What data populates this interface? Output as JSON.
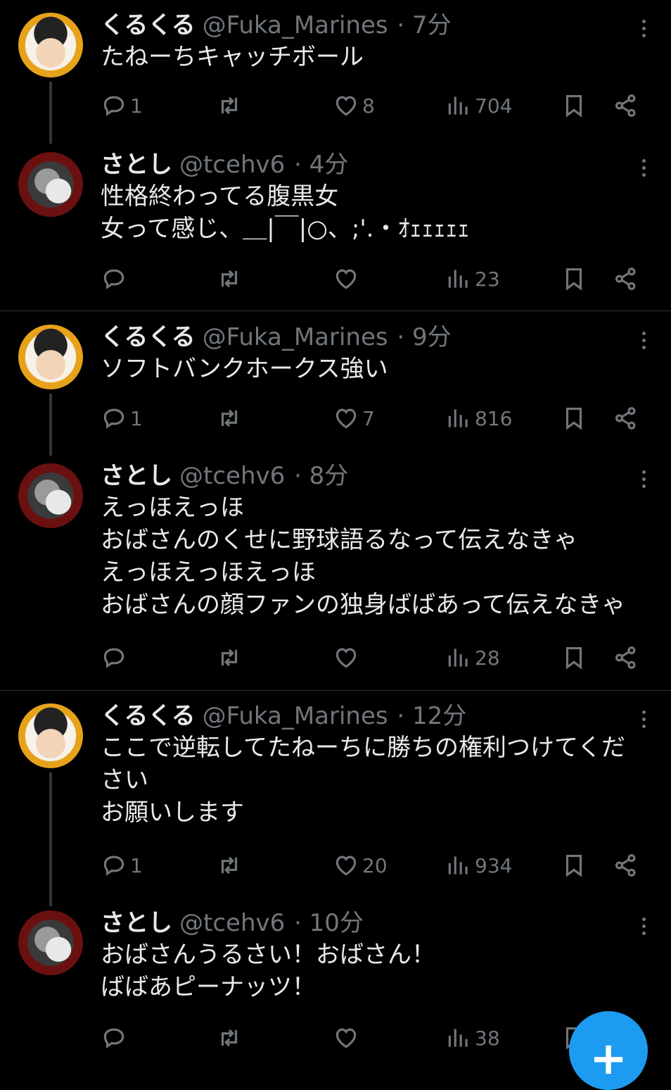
{
  "colors": {
    "background": "#000000",
    "text": "#e7e9ea",
    "muted": "#71767b",
    "accent": "#1d9bf0"
  },
  "icons": {
    "reply": "reply-icon",
    "retweet": "retweet-icon",
    "like": "heart-icon",
    "views": "views-icon",
    "bookmark": "bookmark-icon",
    "share": "share-icon",
    "more": "more-icon",
    "compose": "plus-icon"
  },
  "threads": [
    {
      "posts": [
        {
          "name": "くるくる",
          "handle": "@Fuka_Marines",
          "time": "· 7分",
          "lines": [
            "たねーちキャッチボール"
          ],
          "replies": "1",
          "likes": "8",
          "views": "704"
        },
        {
          "name": "さとし",
          "handle": "@tcehv6",
          "time": "· 4分",
          "lines": [
            "性格終わってる腹黒女",
            "女って感じ、＿|￣|○、;'.・ｵｪｪｪｪｪ"
          ],
          "replies": "",
          "likes": "",
          "views": "23"
        }
      ]
    },
    {
      "posts": [
        {
          "name": "くるくる",
          "handle": "@Fuka_Marines",
          "time": "· 9分",
          "lines": [
            "ソフトバンクホークス強い"
          ],
          "replies": "1",
          "likes": "7",
          "views": "816"
        },
        {
          "name": "さとし",
          "handle": "@tcehv6",
          "time": "· 8分",
          "lines": [
            "えっほえっほ",
            "おばさんのくせに野球語るなって伝えなきゃ",
            "えっほえっほえっほ",
            "おばさんの顔ファンの独身ばばあって伝えなきゃ"
          ],
          "replies": "",
          "likes": "",
          "views": "28"
        }
      ]
    },
    {
      "posts": [
        {
          "name": "くるくる",
          "handle": "@Fuka_Marines",
          "time": "· 12分",
          "lines": [
            "ここで逆転してたねーちに勝ちの権利つけてくだ",
            "さい",
            "お願いします"
          ],
          "replies": "1",
          "likes": "20",
          "views": "934"
        },
        {
          "name": "さとし",
          "handle": "@tcehv6",
          "time": "· 10分",
          "lines": [
            "おばさんうるさい！おばさん！",
            "ばばあピーナッツ！"
          ],
          "replies": "",
          "likes": "",
          "views": "38"
        }
      ]
    }
  ],
  "compose_button": "+"
}
